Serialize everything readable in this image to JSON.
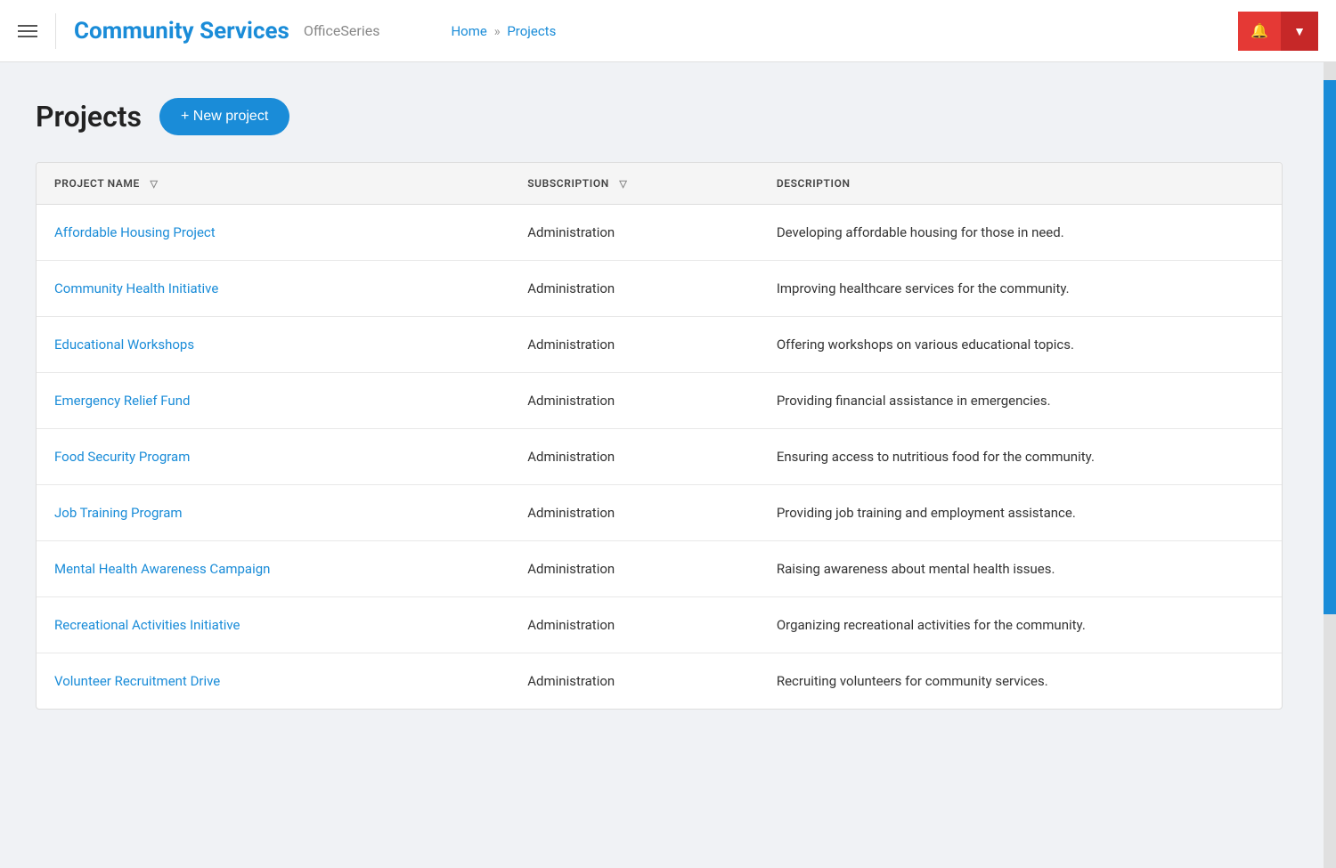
{
  "header": {
    "app_title": "Community Services",
    "app_subtitle": "OfficeSeries",
    "breadcrumb_home": "Home",
    "breadcrumb_separator": "»",
    "breadcrumb_current": "Projects"
  },
  "page": {
    "title": "Projects",
    "new_project_label": "+ New project"
  },
  "table": {
    "columns": [
      {
        "key": "project_name",
        "label": "PROJECT NAME"
      },
      {
        "key": "subscription",
        "label": "SUBSCRIPTION"
      },
      {
        "key": "description",
        "label": "DESCRIPTION"
      }
    ],
    "rows": [
      {
        "project_name": "Affordable Housing Project",
        "subscription": "Administration",
        "description": "Developing affordable housing for those in need."
      },
      {
        "project_name": "Community Health Initiative",
        "subscription": "Administration",
        "description": "Improving healthcare services for the community."
      },
      {
        "project_name": "Educational Workshops",
        "subscription": "Administration",
        "description": "Offering workshops on various educational topics."
      },
      {
        "project_name": "Emergency Relief Fund",
        "subscription": "Administration",
        "description": "Providing financial assistance in emergencies."
      },
      {
        "project_name": "Food Security Program",
        "subscription": "Administration",
        "description": "Ensuring access to nutritious food for the community."
      },
      {
        "project_name": "Job Training Program",
        "subscription": "Administration",
        "description": "Providing job training and employment assistance."
      },
      {
        "project_name": "Mental Health Awareness Campaign",
        "subscription": "Administration",
        "description": "Raising awareness about mental health issues."
      },
      {
        "project_name": "Recreational Activities Initiative",
        "subscription": "Administration",
        "description": "Organizing recreational activities for the community."
      },
      {
        "project_name": "Volunteer Recruitment Drive",
        "subscription": "Administration",
        "description": "Recruiting volunteers for community services."
      }
    ]
  },
  "colors": {
    "primary": "#1a8cd8",
    "danger": "#e53935",
    "danger_dark": "#c62828"
  }
}
